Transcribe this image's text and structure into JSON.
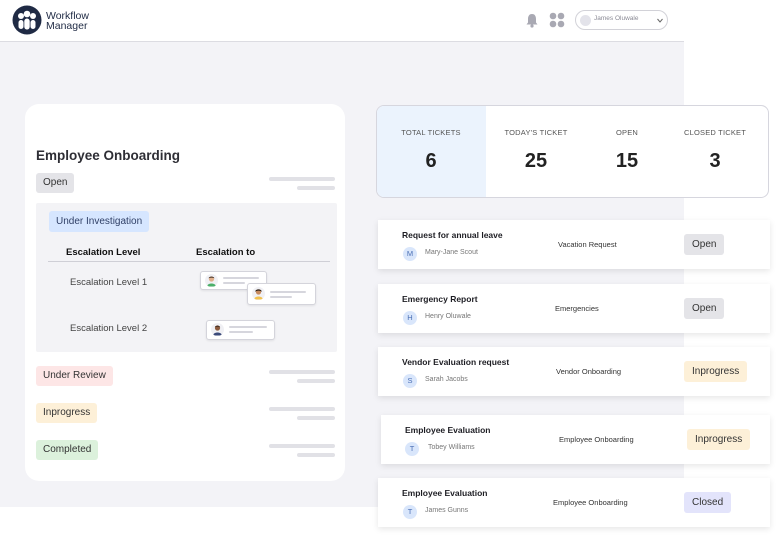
{
  "header": {
    "brand_line1": "Workflow",
    "brand_line2": "Manager",
    "user_name": "James Oluwale",
    "icons": [
      "logo-icon",
      "bell-icon",
      "grid-icon",
      "chevron-down-icon"
    ]
  },
  "workflow": {
    "title": "Employee Onboarding",
    "status_open": "Open",
    "status_investigation": "Under Investigation",
    "escalation_level_header": "Escalation Level",
    "escalation_to_header": "Escalation to",
    "levels": [
      "Escalation Level 1",
      "Escalation Level 2"
    ],
    "status_review": "Under Review",
    "status_inprogress": "Inprogress",
    "status_completed": "Completed"
  },
  "stats": [
    {
      "label": "TOTAL TICKETS",
      "value": "6"
    },
    {
      "label": "TODAY'S TICKET",
      "value": "25"
    },
    {
      "label": "OPEN",
      "value": "15"
    },
    {
      "label": "CLOSED TICKET",
      "value": "3"
    }
  ],
  "tickets": [
    {
      "title": "Request for annual leave",
      "initial": "M",
      "name": "Mary-Jane Scout",
      "category": "Vacation Request",
      "status": "Open"
    },
    {
      "title": "Emergency Report",
      "initial": "H",
      "name": "Henry Oluwale",
      "category": "Emergencies",
      "status": "Open"
    },
    {
      "title": "Vendor Evaluation request",
      "initial": "S",
      "name": "Sarah Jacobs",
      "category": "Vendor Onboarding",
      "status": "Inprogress"
    },
    {
      "title": "Employee Evaluation",
      "initial": "T",
      "name": "Tobey Williams",
      "category": "Employee Onboarding",
      "status": "Inprogress"
    },
    {
      "title": "Employee Evaluation",
      "initial": "T",
      "name": "James Gunns",
      "category": "Employee Onboarding",
      "status": "Closed"
    }
  ],
  "colors": {
    "brand": "#1f2a44",
    "highlight": "#ebf3fd",
    "open": "#e4e4e8",
    "inprogress": "#fdf0d8",
    "closed": "#e3e4fb",
    "review": "#fde6e6",
    "completed": "#dcf1dc",
    "investigation": "#d6e6ff"
  }
}
